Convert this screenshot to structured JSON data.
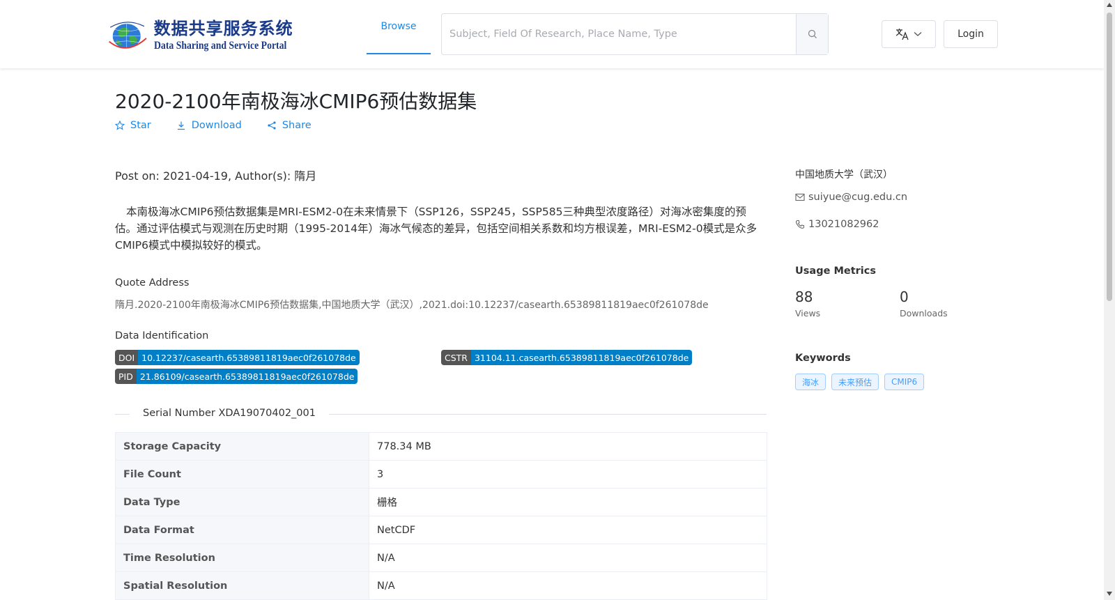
{
  "header": {
    "logo_cn": "数据共享服务系统",
    "logo_en": "Data Sharing and Service Portal",
    "nav_browse": "Browse",
    "search_placeholder": "Subject, Field Of Research, Place Name, Type",
    "login_label": "Login"
  },
  "dataset": {
    "title": "2020-2100年南极海冰CMIP6预估数据集",
    "actions": {
      "star": "Star",
      "download": "Download",
      "share": "Share"
    },
    "meta_line": "Post on: 2021-04-19, Author(s): 隋月",
    "abstract": "本南极海冰CMIP6预估数据集是MRI-ESM2-0在未来情景下（SSP126，SSP245，SSP585三种典型浓度路径）对海冰密集度的预估。通过评估模式与观测在历史时期（1995-2014年）海冰气候态的差异，包括空间相关系数和均方根误差，MRI-ESM2-0模式是众多CMIP6模式中模拟较好的模式。",
    "quote_label": "Quote Address",
    "quote_text": "隋月.2020-2100年南极海冰CMIP6预估数据集,中国地质大学（武汉）,2021.doi:10.12237/casearth.65389811819aec0f261078de",
    "identification_label": "Data Identification",
    "identifiers": {
      "doi": {
        "key": "DOI",
        "value": "10.12237/casearth.65389811819aec0f261078de"
      },
      "cstr": {
        "key": "CSTR",
        "value": "31104.11.casearth.65389811819aec0f261078de"
      },
      "pid": {
        "key": "PID",
        "value": "21.86109/casearth.65389811819aec0f261078de"
      }
    },
    "serial_number": "Serial Number XDA19070402_001",
    "table": [
      {
        "label": "Storage Capacity",
        "value": "778.34 MB"
      },
      {
        "label": "File Count",
        "value": "3"
      },
      {
        "label": "Data Type",
        "value": "栅格"
      },
      {
        "label": "Data Format",
        "value": "NetCDF"
      },
      {
        "label": "Time Resolution",
        "value": "N/A"
      },
      {
        "label": "Spatial Resolution",
        "value": "N/A"
      }
    ]
  },
  "sidebar": {
    "org": "中国地质大学（武汉）",
    "email": "suiyue@cug.edu.cn",
    "phone": "13021082962",
    "usage_title": "Usage Metrics",
    "views_count": "88",
    "views_label": "Views",
    "downloads_count": "0",
    "downloads_label": "Downloads",
    "keywords_title": "Keywords",
    "keywords": [
      "海冰",
      "未来预估",
      "CMIP6"
    ]
  },
  "colors": {
    "accent": "#1e88e5",
    "badge_key": "#555555",
    "badge_value": "#007ec6",
    "keyword_text": "#409eff"
  }
}
